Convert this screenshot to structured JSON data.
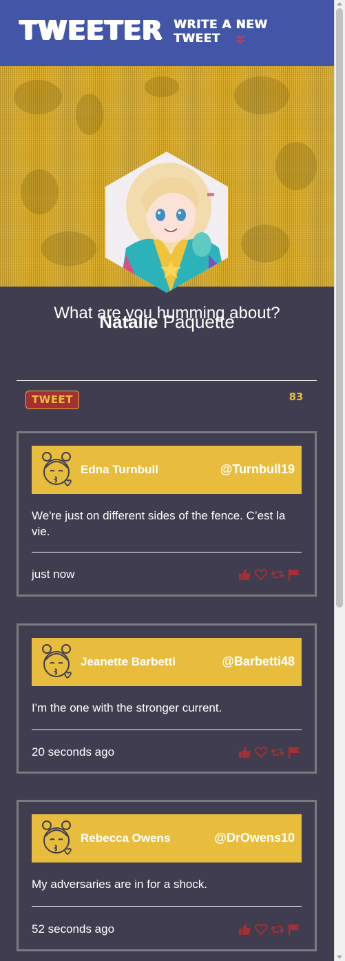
{
  "nav": {
    "brand": "TWEETER",
    "write_label": "WRITE A NEW TWEET",
    "chevron_icon": "double-chevron-down-icon"
  },
  "profile": {
    "first_name": "Natalie",
    "last_name": "Paquette",
    "avatar_icon": "profile-avatar"
  },
  "compose": {
    "prompt": "What are you humming about?",
    "button_label": "TWEET",
    "counter": "83"
  },
  "tweets": [
    {
      "name": "Edna Turnbull",
      "handle": "@Turnbull19",
      "text": "We're just on different sides of the fence. C’est la vie.",
      "time": "just now"
    },
    {
      "name": "Jeanette Barbetti",
      "handle": "@Barbetti48",
      "text": "I'm the one with the stronger current.",
      "time": "20 seconds ago"
    },
    {
      "name": "Rebecca Owens",
      "handle": "@DrOwens10",
      "text": "My adversaries are in for a shock.",
      "time": "52 seconds ago"
    }
  ],
  "colors": {
    "nav": "#4255a6",
    "banner": "#d8ab2c",
    "background": "#3f3d4f",
    "accent_gold": "#e8bd3d",
    "accent_red": "#a52f33"
  },
  "icons": {
    "action_icons": [
      "thumbs-up-icon",
      "heart-icon",
      "retweet-icon",
      "flag-icon"
    ],
    "tweet_avatar": "kissing-face-icon"
  }
}
